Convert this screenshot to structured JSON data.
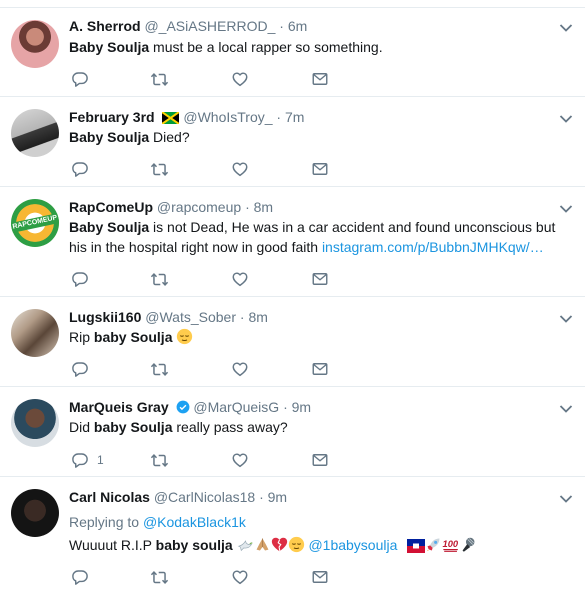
{
  "tweets": [
    {
      "name": "A. Sherrod",
      "handle": "@_ASiASHERROD_",
      "dot": "·",
      "time": "6m",
      "text_bold": "Baby Soulja",
      "text_rest": " must be a local rapper so something."
    },
    {
      "name": "February 3rd",
      "flag": "jamaica-flag",
      "handle": "@WhoIsTroy_",
      "dot": "·",
      "time": "7m",
      "text_bold": "Baby Soulja",
      "text_rest": " Died?"
    },
    {
      "name": "RapComeUp",
      "handle": "@rapcomeup",
      "dot": "·",
      "time": "8m",
      "avatar_text": "RAPCOMEUP",
      "text_bold": "Baby Soulja",
      "text_rest": " is not Dead, He was in a car accident and found unconscious but his in the hospital right now in good faith ",
      "link": "instagram.com/p/BubbnJMHKqw/…"
    },
    {
      "name": "Lugskii160",
      "handle": "@Wats_Sober",
      "dot": "·",
      "time": "8m",
      "text_pre": "Rip ",
      "text_bold": "baby Soulja",
      "emoji": "relieved-face"
    },
    {
      "name": "MarQueis Gray",
      "verified": true,
      "handle": "@MarQueisG",
      "dot": "·",
      "time": "9m",
      "text_pre": "Did ",
      "text_bold": "baby Soulja",
      "text_rest": " really pass away?",
      "reply_count": "1"
    },
    {
      "name": "Carl Nicolas",
      "handle": "@CarlNicolas18",
      "dot": "·",
      "time": "9m",
      "replying_label": "Replying to ",
      "replying_to": "@KodakBlack1k",
      "text_pre": "Wuuuut R.I.P ",
      "text_bold": "baby soulja",
      "mention": "@1babysoulja",
      "emojis": [
        "dove",
        "folded-hands",
        "broken-heart",
        "relieved-face",
        "haiti-flag",
        "rocket",
        "hundred-points",
        "microphone"
      ]
    }
  ],
  "colors": {
    "text": "#14171a",
    "secondary": "#657786",
    "link": "#1b95e0",
    "border": "#e6ecf0",
    "verified": "#1da1f2"
  },
  "action_icons": [
    "reply-icon",
    "retweet-icon",
    "like-icon",
    "direct-message-icon"
  ]
}
